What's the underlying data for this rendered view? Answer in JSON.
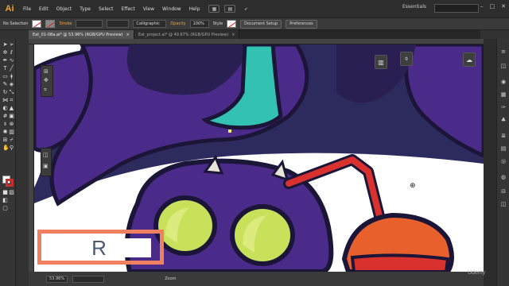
{
  "app": {
    "logo": "Ai"
  },
  "menubar": {
    "items": [
      "File",
      "Edit",
      "Object",
      "Type",
      "Select",
      "Effect",
      "View",
      "Window",
      "Help"
    ],
    "icons": [
      "br-icon",
      "grid-icon",
      "pen-icon"
    ],
    "workspace": "Essentials",
    "window_controls": [
      "–",
      "□",
      "✕"
    ]
  },
  "controlbar": {
    "selection": "No Selection",
    "stroke_label": "Stroke",
    "brush": "Calligraphic",
    "opacity_label": "Opacity",
    "opacity_value": "100%",
    "style_label": "Style",
    "doc_setup": "Document Setup",
    "preferences": "Preferences"
  },
  "tabs": [
    {
      "label": "Eat_01-08a.ai* @ 53.96% (RGB/GPU Preview)",
      "active": true
    },
    {
      "label": "Eat_project.ai* @ 49.67% (RGB/GPU Preview)",
      "active": false
    }
  ],
  "statusbar": {
    "zoom": "53.96%",
    "tool": "Zoom"
  },
  "overlay": {
    "letter": "R"
  },
  "colors": {
    "bg": "#2d2a5e",
    "purple": "#4b2b8a",
    "dark_purple": "#2a1f52",
    "teal": "#33c1b1",
    "lime": "#c8e05a",
    "red_straw": "#d9322e",
    "orange_cup": "#e8612c",
    "outline": "#1b1538",
    "accent": "#f08060"
  },
  "watermark": "Udemy"
}
